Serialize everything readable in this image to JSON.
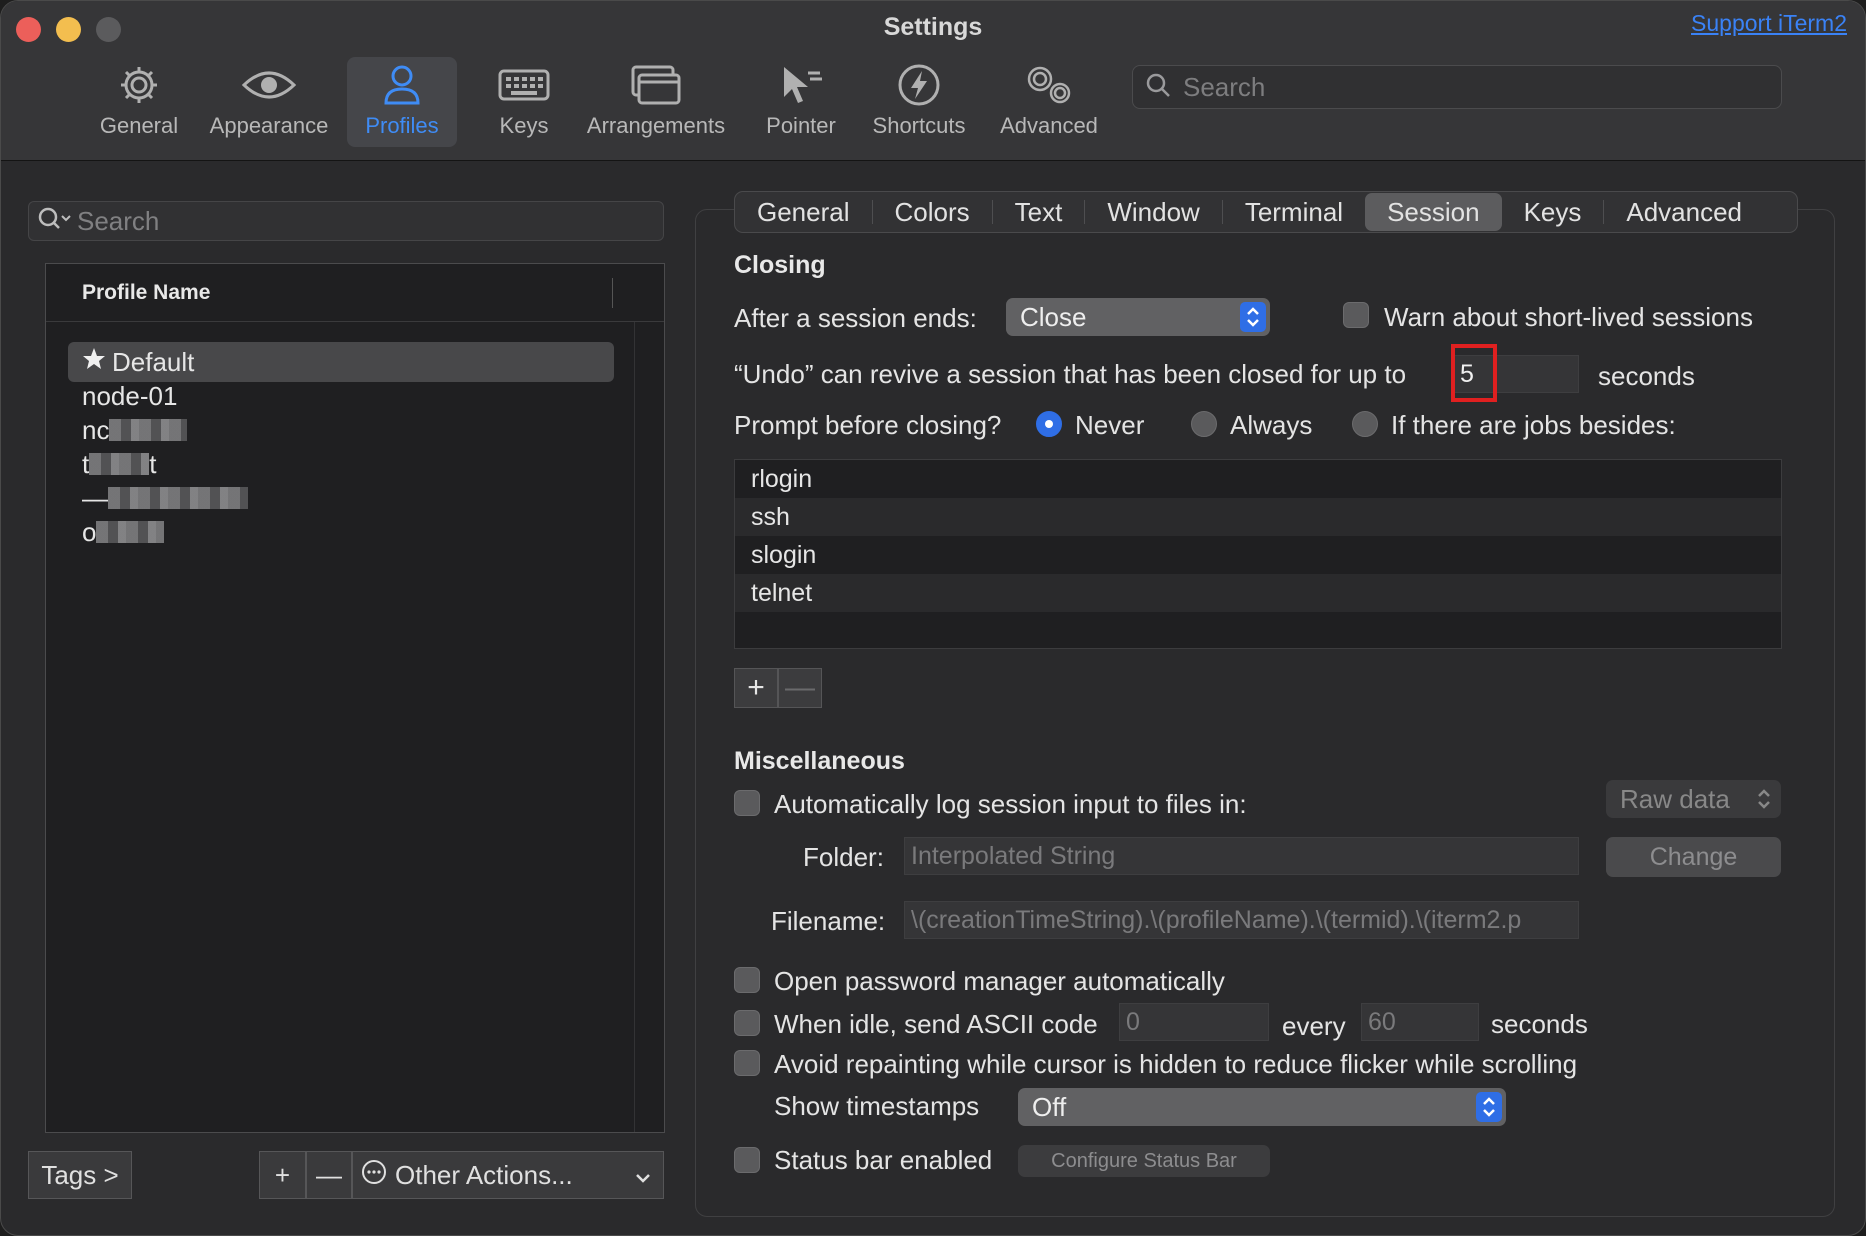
{
  "window": {
    "title": "Settings",
    "support_link": "Support iTerm2"
  },
  "toolbar": {
    "items": [
      {
        "label": "General",
        "icon": "gear-icon"
      },
      {
        "label": "Appearance",
        "icon": "eye-icon"
      },
      {
        "label": "Profiles",
        "icon": "person-icon",
        "active": true
      },
      {
        "label": "Keys",
        "icon": "keyboard-icon"
      },
      {
        "label": "Arrangements",
        "icon": "windows-icon"
      },
      {
        "label": "Pointer",
        "icon": "pointer-icon"
      },
      {
        "label": "Shortcuts",
        "icon": "lightning-icon"
      },
      {
        "label": "Advanced",
        "icon": "gears-icon"
      }
    ],
    "search_placeholder": "Search"
  },
  "profiles_panel": {
    "search_placeholder": "Search",
    "column_header": "Profile Name",
    "profiles": [
      {
        "name": "Default",
        "selected": true,
        "starred": true
      },
      {
        "name": "node-01"
      },
      {
        "name": "nc",
        "redacted": true
      },
      {
        "name": "t",
        "suffix": "t",
        "redacted": true
      },
      {
        "name": "—",
        "redacted": true
      },
      {
        "name": "o",
        "redacted": true
      }
    ],
    "tags_button": "Tags >",
    "add_label": "+",
    "remove_label": "—",
    "other_actions": "Other Actions..."
  },
  "tabs": [
    "General",
    "Colors",
    "Text",
    "Window",
    "Terminal",
    "Session",
    "Keys",
    "Advanced"
  ],
  "active_tab": "Session",
  "closing": {
    "title": "Closing",
    "after_session_ends_label": "After a session ends:",
    "after_session_ends_value": "Close",
    "warn_short_lived_label": "Warn about short-lived sessions",
    "warn_short_lived_checked": false,
    "undo_label": "“Undo” can revive a session that has been closed for up to",
    "undo_value": "5",
    "undo_unit": "seconds",
    "prompt_label": "Prompt before closing?",
    "prompt_options": [
      "Never",
      "Always",
      "If there are jobs besides:"
    ],
    "prompt_selected": "Never",
    "jobs": [
      "rlogin",
      "ssh",
      "slogin",
      "telnet"
    ],
    "add_job": "+",
    "remove_job": "—"
  },
  "misc": {
    "title": "Miscellaneous",
    "auto_log_label": "Automatically log session input to files in:",
    "auto_log_checked": false,
    "log_format": "Raw data",
    "folder_label": "Folder:",
    "folder_placeholder": "Interpolated String",
    "change_button": "Change",
    "filename_label": "Filename:",
    "filename_value": "\\(creationTimeString).\\(profileName).\\(termid).\\(iterm2.p",
    "password_manager_label": "Open password manager automatically",
    "idle_label": "When idle, send ASCII code",
    "idle_code": "0",
    "idle_every": "every",
    "idle_interval": "60",
    "idle_unit": "seconds",
    "avoid_repaint_label": "Avoid repainting while cursor is hidden to reduce flicker while scrolling",
    "timestamps_label": "Show timestamps",
    "timestamps_value": "Off",
    "status_bar_label": "Status bar enabled",
    "configure_status_bar": "Configure Status Bar"
  },
  "colors": {
    "accent": "#2f6ee6",
    "link": "#3a82f6",
    "highlight_box": "#e02020"
  }
}
